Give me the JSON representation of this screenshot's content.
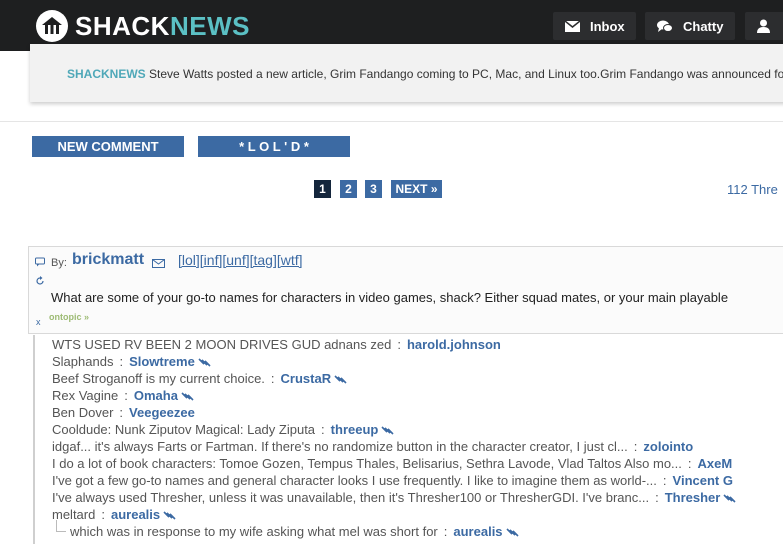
{
  "header": {
    "logo_left": "SHACK",
    "logo_right": "NEWS",
    "inbox_label": "Inbox",
    "chatty_label": "Chatty"
  },
  "article": {
    "brand": "SHACKNEWS",
    "text": "Steve Watts posted a new article, Grim Fandango coming to PC, Mac, and Linux too.Grim Fandango was announced fo"
  },
  "actions": {
    "new_comment": "NEW COMMENT",
    "lold": "* L O L ' D *"
  },
  "pager": {
    "pages": [
      "1",
      "2",
      "3"
    ],
    "current": "1",
    "next": "NEXT »",
    "threads": "112 Thre"
  },
  "post": {
    "by": "By:",
    "author": "brickmatt",
    "tags": "[lol][inf][unf][tag][wtf]",
    "body": "What are some of your go-to names for characters in video games, shack? Either squad mates, or your main playable",
    "ontopic": "ontopic »",
    "mini_icon_x": "x"
  },
  "replies": [
    {
      "text": "WTS USED RV BEEN 2 MOON DRIVES GUD adnans zed",
      "author": "harold.johnson",
      "lol": false
    },
    {
      "text": "Slaphands",
      "author": "Slowtreme",
      "lol": true
    },
    {
      "text": "Beef Stroganoff is my current choice.",
      "author": "CrustaR",
      "lol": true
    },
    {
      "text": "Rex Vagine",
      "author": "Omaha",
      "lol": true
    },
    {
      "text": "Ben Dover",
      "author": "Veegeezee",
      "lol": false
    },
    {
      "text": "Cooldude: Nunk Ziputov Magical: Lady Ziputa",
      "author": "threeup",
      "lol": true
    },
    {
      "text": "idgaf... it's always Farts or Fartman. If there's no randomize button in the character creator, I just cl...",
      "author": "zolointo",
      "lol": false
    },
    {
      "text": "I do a lot of book characters: Tomoe Gozen, Tempus Thales, Belisarius, Sethra Lavode, Vlad Taltos Also mo...",
      "author": "AxeM",
      "lol": false
    },
    {
      "text": "I've got a few go-to names and general character looks I use frequently. I like to imagine them as world-...",
      "author": "Vincent G",
      "lol": false
    },
    {
      "text": "I've always used Thresher, unless it was unavailable, then it's Thresher100 or ThresherGDI. I've branc...",
      "author": "Thresher",
      "lol": true
    },
    {
      "text": "meltard",
      "author": "aurealis",
      "lol": true
    },
    {
      "text": "which was in response to my wife asking what mel was short for",
      "author": "aurealis",
      "lol": true
    }
  ],
  "colors": {
    "topbar": "#1e1f20",
    "accent": "#3c6aa3",
    "brand_teal": "#5bc0c4"
  }
}
